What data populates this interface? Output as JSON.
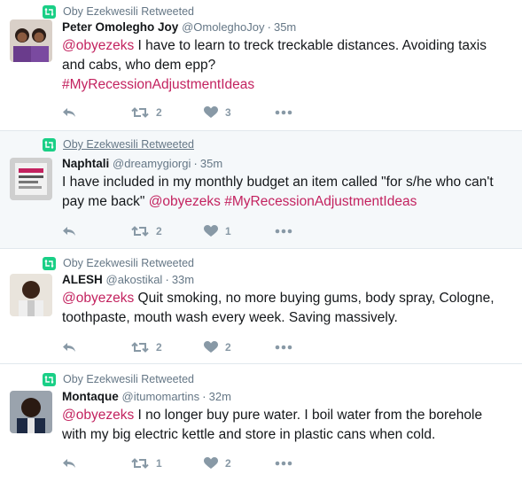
{
  "accent_link": "#c3225f",
  "retweet_badge_color": "#19cf86",
  "tweets": [
    {
      "retweeted_by": "Oby Ezekwesili Retweeted",
      "name": "Peter Omolegho Joy",
      "handle": "@OmoleghoJoy",
      "time": "35m",
      "mention": "@obyezeks",
      "line1": " I have to learn to treck treckable distances. Avoiding taxis",
      "line2": "and cabs, who dem epp?",
      "hashtag": "#MyRecessionAdjustmentIdeas",
      "retweets": "2",
      "likes": "3"
    },
    {
      "retweeted_by": "Oby Ezekwesili Retweeted",
      "name": "Naphtali",
      "handle": "@dreamygiorgi",
      "time": "35m",
      "line1": "I have included in my monthly budget an item called \"for s/he who can't",
      "line2_prefix": "pay me back\" ",
      "mention": "@obyezeks",
      "hashtag": "#MyRecessionAdjustmentIdeas",
      "retweets": "2",
      "likes": "1"
    },
    {
      "retweeted_by": "Oby Ezekwesili Retweeted",
      "name": "ALESH",
      "handle": "@akostikal",
      "time": "33m",
      "mention": "@obyezeks",
      "line1": " Quit smoking, no more buying gums, body spray, Cologne,",
      "line2": "toothpaste, mouth wash every week. Saving massively.",
      "retweets": "2",
      "likes": "2"
    },
    {
      "retweeted_by": "Oby Ezekwesili Retweeted",
      "name": "Montaque",
      "handle": "@itumomartins",
      "time": "32m",
      "mention": "@obyezeks",
      "line1": " I no longer buy pure water. I boil water from the borehole",
      "line2": "with my big electric kettle and store in plastic cans when cold.",
      "retweets": "1",
      "likes": "2"
    }
  ]
}
